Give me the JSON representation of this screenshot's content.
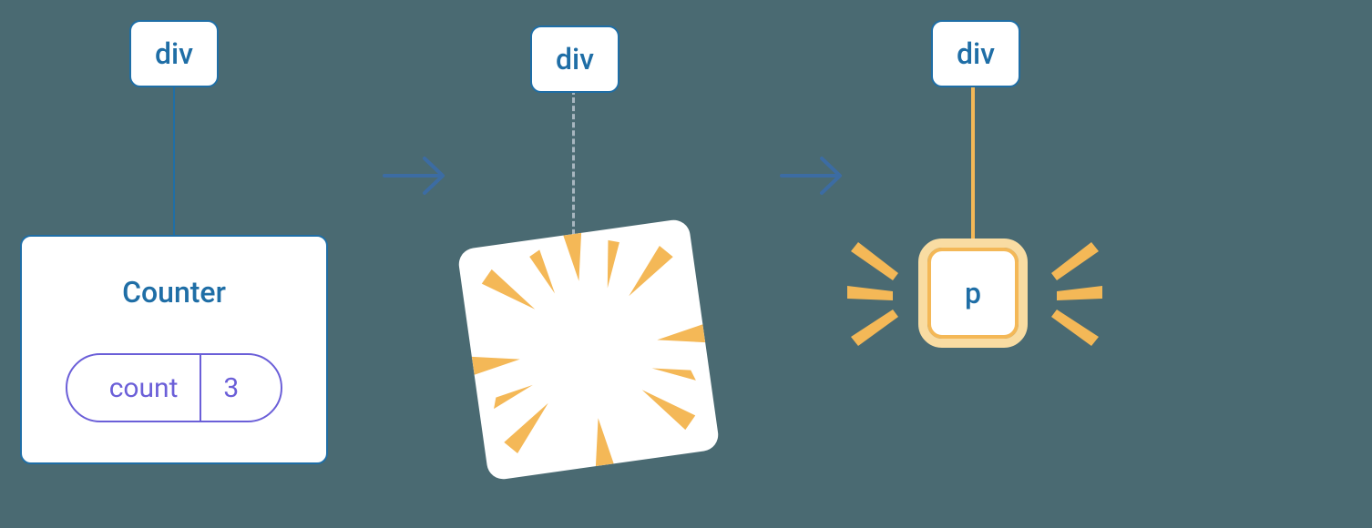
{
  "colors": {
    "bg": "#4a6a72",
    "blue": "#1f6ea6",
    "arrow": "#3c6ca3",
    "purple": "#6b5fd8",
    "gold": "#f4b857",
    "goldLight": "#f9dca2",
    "gray": "#a8b6c0"
  },
  "panels": {
    "panel1": {
      "div": {
        "label": "div"
      },
      "card": {
        "title": "Counter"
      },
      "pill": {
        "key": "count",
        "value": "3"
      }
    },
    "panel2": {
      "div": {
        "label": "div"
      }
    },
    "panel3": {
      "div": {
        "label": "div"
      },
      "pnode": {
        "label": "p"
      }
    }
  }
}
